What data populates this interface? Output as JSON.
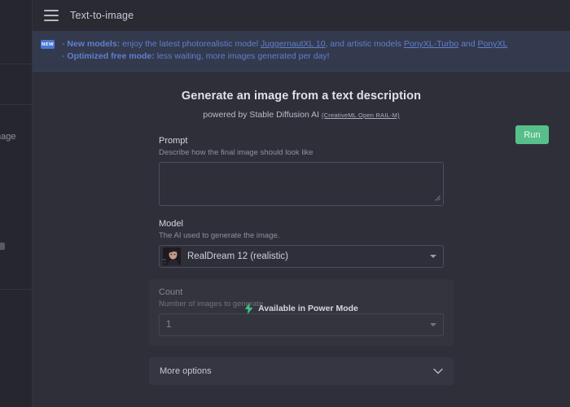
{
  "topbar": {
    "menu_icon": "hamburger-icon",
    "title": "Text-to-image"
  },
  "banner": {
    "badge": "NEW",
    "line1": {
      "bullet": "-",
      "strong": "New models",
      "colon": ":",
      "text_a": " enjoy the latest photorealistic model ",
      "link_a": "JuggernautXL 10",
      "text_b": ", and artistic models ",
      "link_b": "PonyXL-Turbo",
      "text_c": " and ",
      "link_c": "PonyXL"
    },
    "line2": {
      "bullet": "-",
      "strong": "Optimized free mode",
      "colon": ":",
      "text_a": " less waiting, more images generated per day!"
    },
    "link_color": "#5f7fd0",
    "background": "#343a4d"
  },
  "headings": {
    "title": "Generate an image from a text description",
    "subtitle": "powered by Stable Diffusion AI",
    "license_link": "(CreativeML Open RAIL-M)"
  },
  "form": {
    "prompt": {
      "label": "Prompt",
      "help": "Describe how the final image should look like",
      "value": "",
      "placeholder": ""
    },
    "model": {
      "label": "Model",
      "help": "The AI used to generate the image.",
      "selected": "RealDream 12 (realistic)",
      "thumbnail_icon": "model-thumbnail-portrait",
      "caret_icon": "chevron-down-icon"
    },
    "count": {
      "label": "Count",
      "help": "Number of images to generate",
      "selected": "1",
      "disabled": true,
      "overlay_icon": "lightning-bolt-icon",
      "overlay_label": "Available in Power Mode",
      "overlay_accent": "#3fc183",
      "caret_icon": "chevron-down-icon"
    },
    "more_options": {
      "label": "More options",
      "caret_icon": "chevron-down-icon",
      "expanded": false
    }
  },
  "actions": {
    "run_label": "Run",
    "run_color": "#57c08a"
  },
  "background_drawer": {
    "clipped_text_1": "mage",
    "clipped_text_2": ":"
  },
  "theme": {
    "page_background": "#24242c",
    "surface": "#2f2f3a",
    "topbar": "#2a2a33",
    "panel": "#34343f",
    "border": "#4c4f5c",
    "text_primary": "#d8dae0",
    "text_muted": "#8d909a"
  }
}
